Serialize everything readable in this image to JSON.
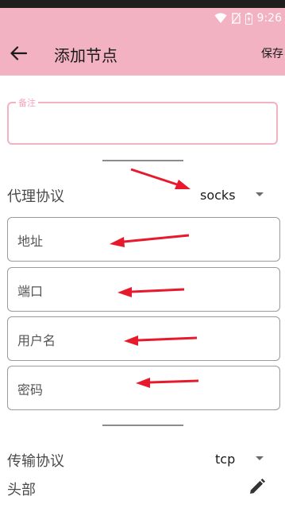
{
  "status_bar": {
    "time": "9:26",
    "icons": [
      "wifi-icon",
      "no-sim-icon",
      "battery-icon"
    ]
  },
  "toolbar": {
    "title": "添加节点",
    "save_label": "保存",
    "back_icon": "arrow-left-icon"
  },
  "remark": {
    "label": "备注",
    "value": ""
  },
  "proxy": {
    "label": "代理协议",
    "selected": "socks"
  },
  "fields": [
    {
      "placeholder": "地址"
    },
    {
      "placeholder": "端口"
    },
    {
      "placeholder": "用户名"
    },
    {
      "placeholder": "密码"
    }
  ],
  "transport": {
    "label": "传输协议",
    "selected": "tcp"
  },
  "header": {
    "label": "头部",
    "icon": "pencil-icon"
  },
  "colors": {
    "accent": "#f2b2c2",
    "annotation_arrow": "#e8192c"
  }
}
